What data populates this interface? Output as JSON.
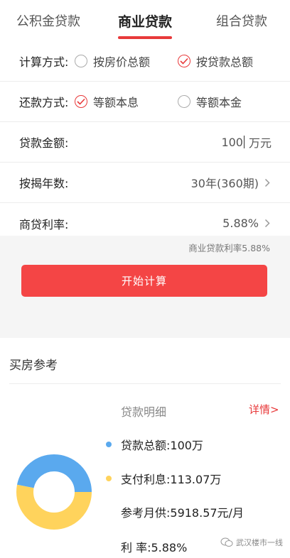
{
  "tabs": [
    {
      "label": "公积金贷款",
      "active": false
    },
    {
      "label": "商业贷款",
      "active": true
    },
    {
      "label": "组合贷款",
      "active": false
    }
  ],
  "form": {
    "calc_method": {
      "label": "计算方式:",
      "options": [
        "按房价总额",
        "按贷款总额"
      ],
      "selected": "按贷款总额"
    },
    "repay_method": {
      "label": "还款方式:",
      "options": [
        "等额本息",
        "等额本金"
      ],
      "selected": "等额本息"
    },
    "loan_amount": {
      "label": "贷款金额:",
      "value": "100",
      "unit": "万元"
    },
    "years": {
      "label": "按揭年数:",
      "value": "30年(360期)"
    },
    "rate": {
      "label": "商贷利率:",
      "value": "5.88%"
    }
  },
  "note": "商业贷款利率5.88%",
  "calc_button": "开始计算",
  "reference": {
    "title": "买房参考",
    "detail_title": "贷款明细",
    "detail_link": "详情>",
    "legend": [
      {
        "label": "贷款总额:100万",
        "color": "#5aa9ee",
        "value": 100
      },
      {
        "label": "支付利息:113.07万",
        "color": "#ffd35c",
        "value": 113.07
      }
    ],
    "monthly": "参考月供:5918.57元/月",
    "rate": "利 率:5.88%"
  },
  "watermark": "武汉楼市一线",
  "colors": {
    "accent": "#e8393a",
    "principal": "#5aa9ee",
    "interest": "#ffd35c"
  }
}
